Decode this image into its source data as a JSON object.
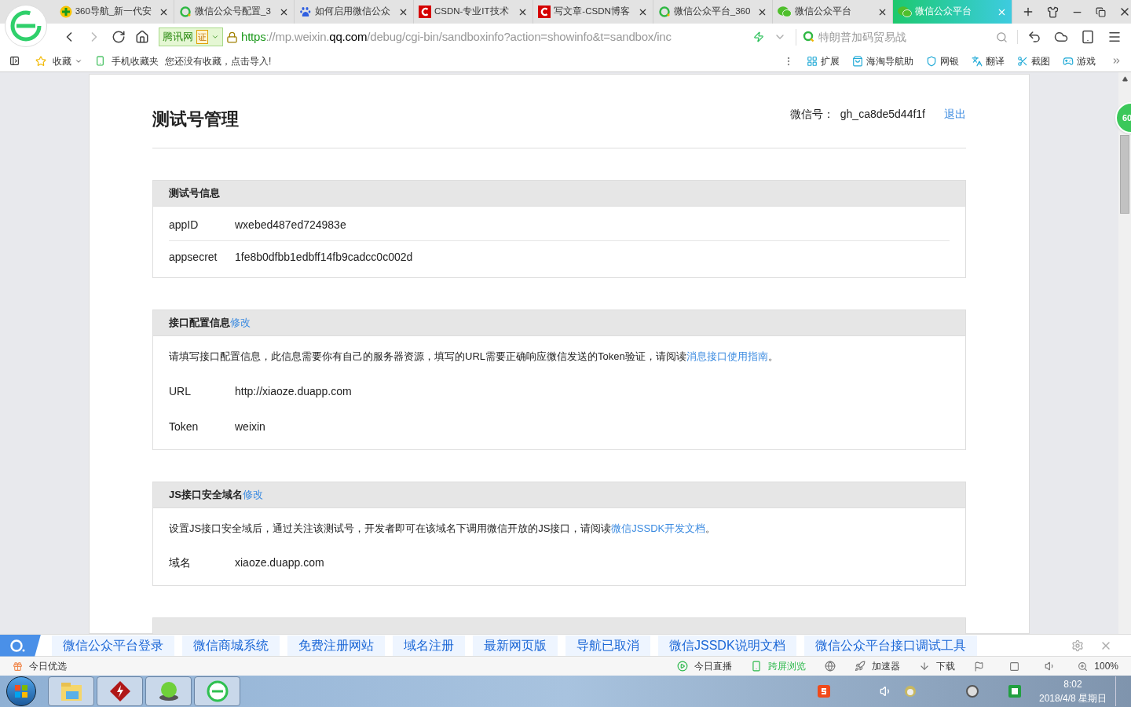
{
  "tabs": [
    {
      "title": "360导航_新一代安",
      "selected": false
    },
    {
      "title": "微信公众号配置_3",
      "selected": false
    },
    {
      "title": "如何启用微信公众",
      "selected": false
    },
    {
      "title": "CSDN-专业IT技术",
      "selected": false
    },
    {
      "title": "写文章-CSDN博客",
      "selected": false
    },
    {
      "title": "微信公众平台_360",
      "selected": false
    },
    {
      "title": "微信公众平台",
      "selected": false
    },
    {
      "title": "微信公众平台",
      "selected": true
    }
  ],
  "address": {
    "site_badge": "腾讯网",
    "cert": "证",
    "scheme": "https",
    "pre_domain": "://mp.weixin.",
    "domain": "qq.com",
    "path": "/debug/cgi-bin/sandboxinfo?action=showinfo&t=sandbox/inc"
  },
  "search": {
    "placeholder": "特朗普加码贸易战"
  },
  "bookmarks": {
    "favorites": "收藏",
    "mobile": "手机收藏夹",
    "empty_hint": "您还没有收藏，点击导入!",
    "tools": [
      "扩展",
      "海淘导航助",
      "网银",
      "翻译",
      "截图",
      "游戏"
    ]
  },
  "page": {
    "title": "测试号管理",
    "account_label": "微信号：",
    "account": "gh_ca8de5d44f1f",
    "logout": "退出",
    "sections": [
      {
        "title": "测试号信息",
        "fields": [
          {
            "label": "appID",
            "value": "wxebed487ed724983e"
          },
          {
            "label": "appsecret",
            "value": "1fe8b0dfbb1edbff14fb9cadcc0c002d"
          }
        ]
      },
      {
        "title": "接口配置信息",
        "edit": "修改",
        "note": {
          "before": "请填写接口配置信息，此信息需要你有自己的服务器资源，填写的URL需要正确响应微信发送的Token验证，请阅读",
          "link": "消息接口使用指南",
          "after": "。"
        },
        "fields": [
          {
            "label": "URL",
            "value": "http://xiaoze.duapp.com"
          },
          {
            "label": "Token",
            "value": "weixin"
          }
        ]
      },
      {
        "title": "JS接口安全域名",
        "edit": "修改",
        "note": {
          "before": "设置JS接口安全域后，通过关注该测试号，开发者即可在该域名下调用微信开放的JS接口，请阅读",
          "link": "微信JSSDK开发文档",
          "after": "。"
        },
        "fields": [
          {
            "label": "域名",
            "value": "xiaoze.duapp.com"
          }
        ]
      }
    ]
  },
  "float_badge": "60",
  "nav_links": [
    "微信公众平台登录",
    "微信商城系统",
    "免费注册网站",
    "域名注册",
    "最新网页版",
    "导航已取消",
    "微信JSSDK说明文档",
    "微信公众平台接口调试工具"
  ],
  "status_bar": {
    "left": "今日优选",
    "live": "今日直播",
    "cross": "跨屏浏览",
    "accel": "加速器",
    "download": "下载",
    "zoom": "100%"
  },
  "taskbar": {
    "time": "8:02",
    "date": "2018/4/8 星期日"
  }
}
